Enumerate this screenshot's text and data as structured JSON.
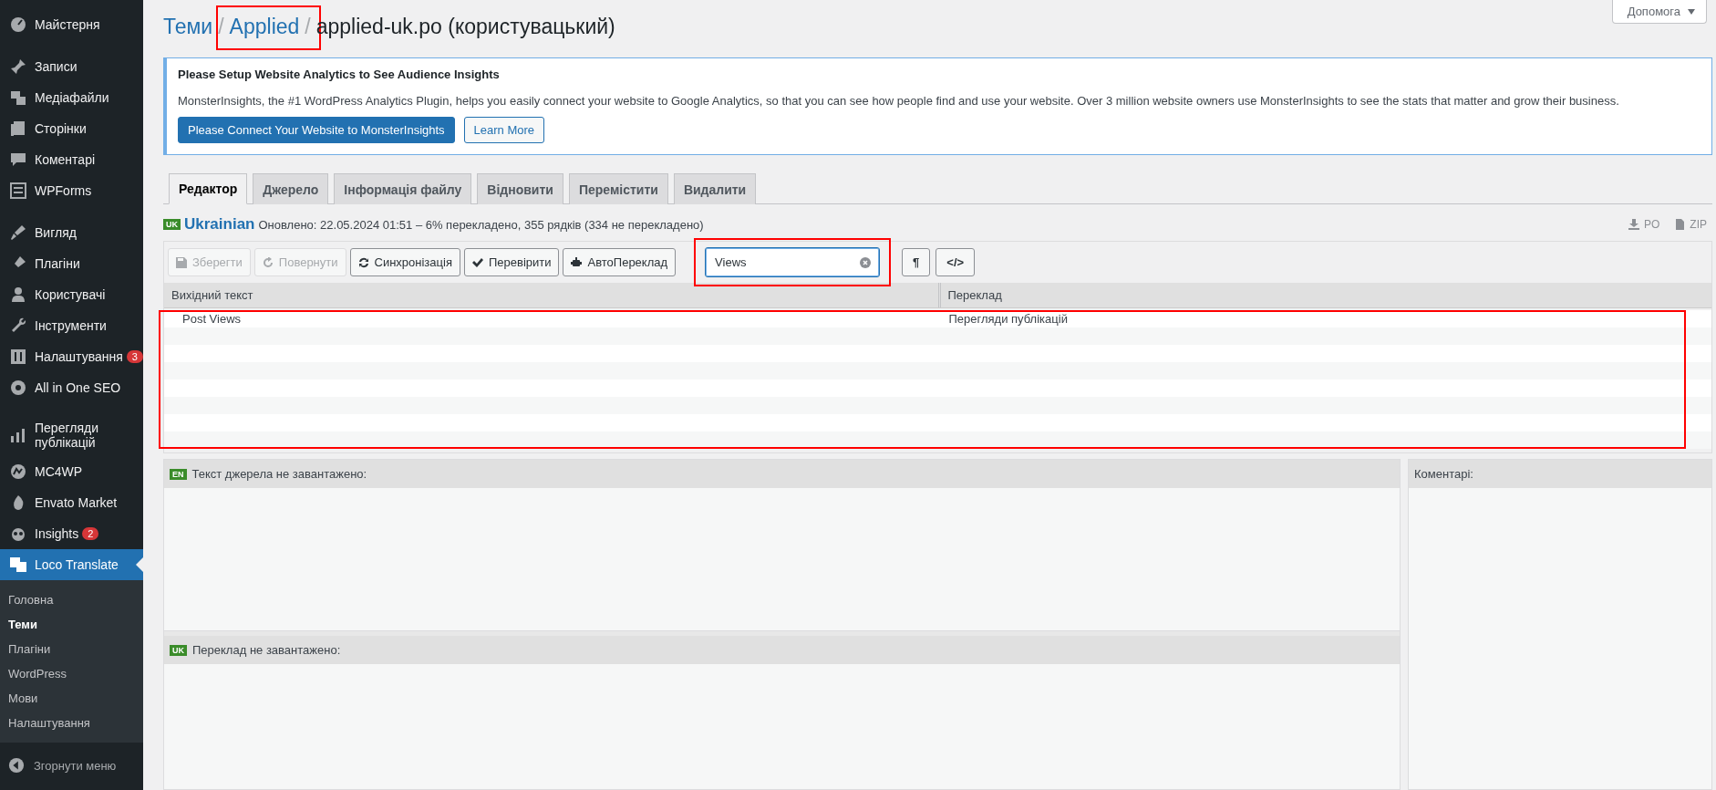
{
  "sidebar": {
    "groups": [
      {
        "items": [
          {
            "label": "Майстерня",
            "selected": false
          }
        ]
      },
      {
        "items": [
          {
            "label": "Записи",
            "selected": false
          },
          {
            "label": "Медіафайли",
            "selected": false
          },
          {
            "label": "Сторінки",
            "selected": false
          },
          {
            "label": "Коментарі",
            "selected": false
          },
          {
            "label": "WPForms",
            "selected": false
          }
        ]
      },
      {
        "items": [
          {
            "label": "Вигляд",
            "selected": false
          },
          {
            "label": "Плагіни",
            "selected": false
          },
          {
            "label": "Користувачі",
            "selected": false
          },
          {
            "label": "Інструменти",
            "selected": false
          },
          {
            "label": "Налаштування",
            "selected": false,
            "badge": "3"
          },
          {
            "label": "All in One SEO",
            "selected": false
          }
        ]
      },
      {
        "items": [
          {
            "label": "Перегляди публікацій",
            "selected": false
          },
          {
            "label": "MC4WP",
            "selected": false
          },
          {
            "label": "Envato Market",
            "selected": false
          },
          {
            "label": "Insights",
            "selected": false,
            "badge": "2"
          },
          {
            "label": "Loco Translate",
            "selected": true,
            "children": [
              {
                "label": "Головна",
                "selected": false
              },
              {
                "label": "Теми",
                "selected": true
              },
              {
                "label": "Плагіни",
                "selected": false
              },
              {
                "label": "WordPress",
                "selected": false
              },
              {
                "label": "Мови",
                "selected": false
              },
              {
                "label": "Налаштування",
                "selected": false
              }
            ]
          }
        ]
      }
    ],
    "collapse": "Згорнути меню"
  },
  "help_button": "Допомога",
  "breadcrumb": [
    {
      "text": "Теми",
      "kind": "link",
      "highlighted": false
    },
    {
      "text": "/",
      "kind": "separator"
    },
    {
      "text": "Applied",
      "kind": "link",
      "highlighted": true
    },
    {
      "text": "/",
      "kind": "separator"
    },
    {
      "text": "applied-uk.po (користувацький)",
      "kind": "plain",
      "highlighted": false
    }
  ],
  "notice": {
    "title": "Please Setup Website Analytics to See Audience Insights",
    "text": "MonsterInsights, the #1 WordPress Analytics Plugin, helps you easily connect your website to Google Analytics, so that you can see how people find and use your website. Over 3 million website owners use MonsterInsights to see the stats that matter and grow their business.",
    "buttons": [
      {
        "label": "Please Connect Your Website to MonsterInsights",
        "kind": "primary"
      },
      {
        "label": "Learn More",
        "kind": "secondary"
      }
    ]
  },
  "tabs": [
    {
      "label": "Редактор",
      "selected": true
    },
    {
      "label": "Джерело",
      "selected": false
    },
    {
      "label": "Інформація файлу",
      "selected": false
    },
    {
      "label": "Відновити",
      "selected": false
    },
    {
      "label": "Перемістити",
      "selected": false
    },
    {
      "label": "Видалити",
      "selected": false
    }
  ],
  "locale": {
    "code": "UK",
    "name": "Ukrainian",
    "status": "Оновлено: 22.05.2024 01:51 – 6% перекладено, 355 рядків (334 не перекладено)"
  },
  "downloads": [
    "PO",
    "ZIP"
  ],
  "toolbar": {
    "buttons": [
      {
        "label": "Зберегти",
        "disabled": true
      },
      {
        "label": "Повернути",
        "disabled": true
      },
      {
        "label": "Синхронізація",
        "disabled": false
      },
      {
        "label": "Перевірити",
        "disabled": false
      },
      {
        "label": "АвтоПереклад",
        "disabled": false
      }
    ],
    "search": {
      "value": "Views",
      "highlighted": true
    },
    "toggles": [
      "¶",
      "</>"
    ]
  },
  "table": {
    "columns": [
      "Вихідний текст",
      "Переклад"
    ],
    "highlighted": true,
    "rows": [
      {
        "source": "Post Views",
        "translation": "Перегляди публікацій"
      }
    ]
  },
  "source_panel": {
    "code": "EN",
    "title": "Текст джерела не завантажено:"
  },
  "translation_panel": {
    "code": "UK",
    "title": "Переклад не завантажено:"
  },
  "comments_panel": {
    "title": "Коментарі:"
  }
}
